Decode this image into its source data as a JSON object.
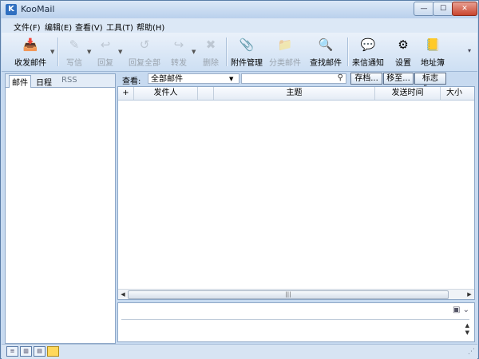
{
  "window": {
    "title": "KooMail",
    "app_icon": "K",
    "min": "—",
    "max": "☐",
    "close": "✕"
  },
  "menu": [
    "文件(F)",
    "编辑(E)",
    "查看(V)",
    "工具(T)",
    "帮助(H)"
  ],
  "toolbar": {
    "receive": "收发邮件",
    "compose": "写信",
    "reply": "回复",
    "reply_all": "回复全部",
    "forward": "转发",
    "delete": "删除",
    "attachments": "附件管理",
    "sort": "分类邮件",
    "find": "查找邮件",
    "notify": "来信通知",
    "settings": "设置",
    "address_book": "地址簿"
  },
  "left_tabs": [
    "邮件",
    "日程",
    "RSS"
  ],
  "filter": {
    "label": "查看:",
    "value": "全部邮件"
  },
  "actions": {
    "archive": "存档...",
    "move": "移至...",
    "flag": "标志为..."
  },
  "columns": {
    "star": "+",
    "sender": "发件人",
    "subject": "主题",
    "date": "发送时间",
    "size": "大小"
  },
  "colors": {
    "accent": "#2f6fc0",
    "frame": "#c7daf0"
  }
}
